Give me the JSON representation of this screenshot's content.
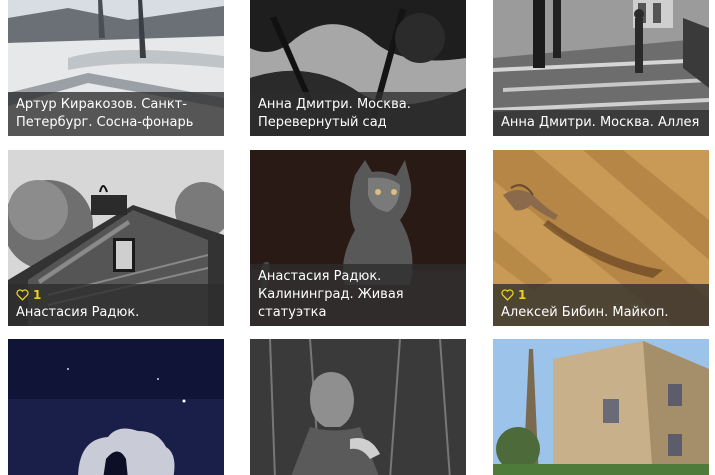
{
  "gallery": {
    "accent_color": "#e8d21d",
    "cards": [
      {
        "title": "Артур Киракозов. Санкт-Петербург. Сосна-фонарь"
      },
      {
        "title": "Анна Дмитри. Москва. Перевернутый сад"
      },
      {
        "title": "Анна Дмитри. Москва. Аллея"
      },
      {
        "title": "Анастасия Радюк.",
        "likes": "1"
      },
      {
        "title": "Анастасия Радюк. Калининград. Живая статуэтка"
      },
      {
        "title": "Алексей Бибин. Майкоп.",
        "likes": "1"
      },
      {
        "title": ""
      },
      {
        "title": ""
      },
      {
        "title": ""
      }
    ]
  }
}
